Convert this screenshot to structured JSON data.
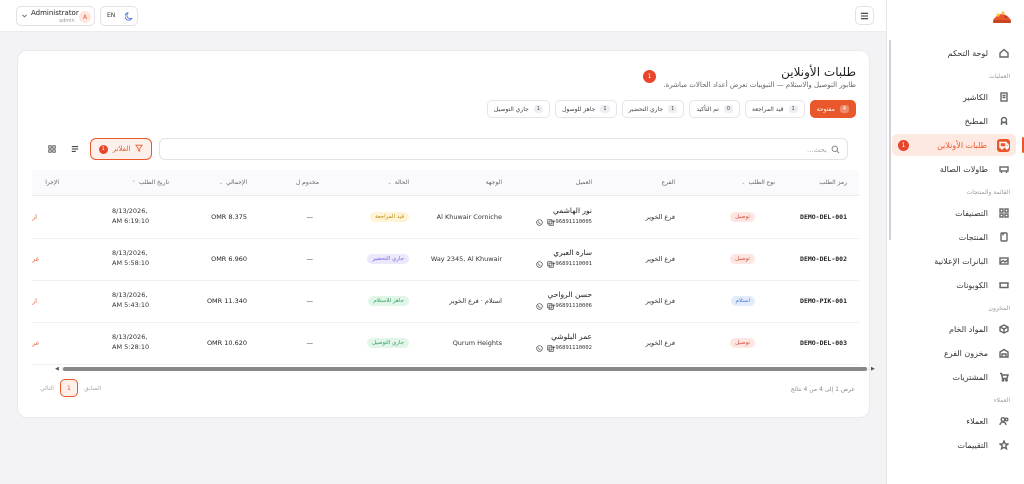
{
  "topbar": {
    "user_name": "Administrator",
    "user_role": "admin",
    "avatar_letter": "A",
    "language": "EN"
  },
  "sidebar": {
    "sections": {
      "operations": "العمليات",
      "menu_offers": "القائمة والمنتجات",
      "inventory": "المخزون",
      "customers": "العملاء"
    },
    "items": {
      "dashboard": "لوحة التحكم",
      "cashier": "الكاشير",
      "kitchen": "المطبخ",
      "online_orders": "طلبات الأونلاين",
      "tables": "طاولات الصالة",
      "categories": "التصنيفات",
      "products": "المنتجات",
      "banners": "البانرات الإعلانية",
      "coupons": "الكوبونات",
      "raw_materials": "المواد الخام",
      "branch_stock": "مخزون الفرع",
      "purchases": "المشتريات",
      "customers": "العملاء",
      "ratings": "التقييمات"
    },
    "online_orders_badge": "1"
  },
  "card": {
    "title": "طلبات الأونلاين",
    "subtitle": "طابور التوصيل والاستلام — التبويبات تعرض أعداد الحالات مباشرة.",
    "title_badge": "1"
  },
  "tabs": [
    {
      "label": "مفتوحة",
      "count": "4"
    },
    {
      "label": "قيد المراجعة",
      "count": "1"
    },
    {
      "label": "تم التأكيد",
      "count": "0"
    },
    {
      "label": "جاري التحضير",
      "count": "1"
    },
    {
      "label": "جاهز للوصول",
      "count": "1"
    },
    {
      "label": "جاري التوصيل",
      "count": "1"
    }
  ],
  "search": {
    "placeholder": "بحث..."
  },
  "filter": {
    "label": "الفلاتر",
    "count": "1"
  },
  "table": {
    "headers": {
      "code": "رمز الطلب",
      "type": "نوع الطلب",
      "branch": "الفرع",
      "customer": "العميل",
      "destination": "الوجهة",
      "status": "الحالة",
      "driver": "مخدوم ل",
      "total": "الإجمالي",
      "date": "تاريخ الطلب",
      "actions": "الإجرا"
    },
    "rows": [
      {
        "code": "DEMO-DEL-001",
        "type": "توصيل",
        "branch": "فرع الخوير",
        "name": "نور الهاشمي",
        "phone": "+96891110005",
        "destination": "Al Khuwair Corniche",
        "status": "قيد المراجعة",
        "driver": "—",
        "total": "OMR 8.375",
        "date": "8/13/2026,",
        "time": "AM 6:19:10",
        "action": "ار"
      },
      {
        "code": "DEMO-DEL-002",
        "type": "توصيل",
        "branch": "فرع الخوير",
        "name": "سارة العبري",
        "phone": "+96891110001",
        "destination": "Way 2345, Al Khuwair",
        "status": "جاري التحضير",
        "driver": "—",
        "total": "OMR 6.960",
        "date": "8/13/2026,",
        "time": "AM 5:58:10",
        "action": "عر"
      },
      {
        "code": "DEMO-PIK-001",
        "type": "استلام",
        "branch": "فرع الخوير",
        "name": "حسن الرواحي",
        "phone": "+96891110006",
        "destination": "استلام · فرع الخوير",
        "status": "جاهز للاستلام",
        "driver": "—",
        "total": "OMR 11.340",
        "date": "8/13/2026,",
        "time": "AM 5:43:10",
        "action": "ار"
      },
      {
        "code": "DEMO-DEL-003",
        "type": "توصيل",
        "branch": "فرع الخوير",
        "name": "عمر البلوشي",
        "phone": "+96891110002",
        "destination": "Qurum Heights",
        "status": "جاري التوصيل",
        "driver": "—",
        "total": "OMR 10.620",
        "date": "8/13/2026,",
        "time": "AM 5:28:10",
        "action": "عر"
      }
    ]
  },
  "pagination": {
    "info": "عرض 1 إلى 4 من 4 نتائج",
    "prev": "السابق",
    "current": "1",
    "next": "التالي"
  },
  "colors": {
    "accent": "#e9582b",
    "badge": "#e8452c"
  }
}
